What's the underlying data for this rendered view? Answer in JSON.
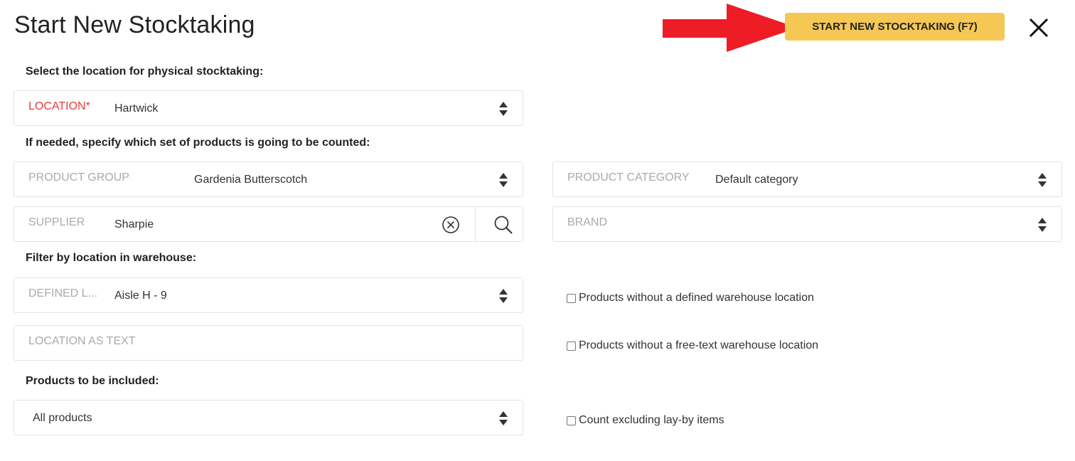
{
  "header": {
    "title": "Start New Stocktaking",
    "start_button": "START NEW STOCKTAKING (F7)"
  },
  "colors": {
    "accent": "#f5c754",
    "arrow": "#ee1c25",
    "required": "#e0403a"
  },
  "sections": {
    "select_location": "Select the location for physical stocktaking:",
    "product_set": "If needed, specify which set of products is going to be counted:",
    "filter_location": "Filter by location in warehouse:",
    "products_included": "Products to be included:"
  },
  "fields": {
    "location": {
      "label": "LOCATION*",
      "value": "Hartwick"
    },
    "product_group": {
      "label": "PRODUCT GROUP",
      "value": "Gardenia Butterscotch"
    },
    "product_category": {
      "label": "PRODUCT CATEGORY",
      "value": "Default category"
    },
    "supplier": {
      "label": "SUPPLIER",
      "value": "Sharpie"
    },
    "brand": {
      "label": "BRAND",
      "value": ""
    },
    "defined_location": {
      "label": "DEFINED L...",
      "value": "Aisle H - 9"
    },
    "location_text": {
      "label": "LOCATION AS TEXT",
      "value": ""
    },
    "products_included": {
      "value": "All products"
    }
  },
  "checkboxes": {
    "no_defined_location": {
      "label": "Products without a defined warehouse location",
      "checked": false
    },
    "no_freetext_location": {
      "label": "Products without a free-text warehouse location",
      "checked": false
    },
    "exclude_layby": {
      "label": "Count excluding lay-by items",
      "checked": false
    }
  },
  "icons": [
    "arrow-right-icon",
    "close-icon",
    "sort-icon",
    "clear-icon",
    "search-icon"
  ]
}
